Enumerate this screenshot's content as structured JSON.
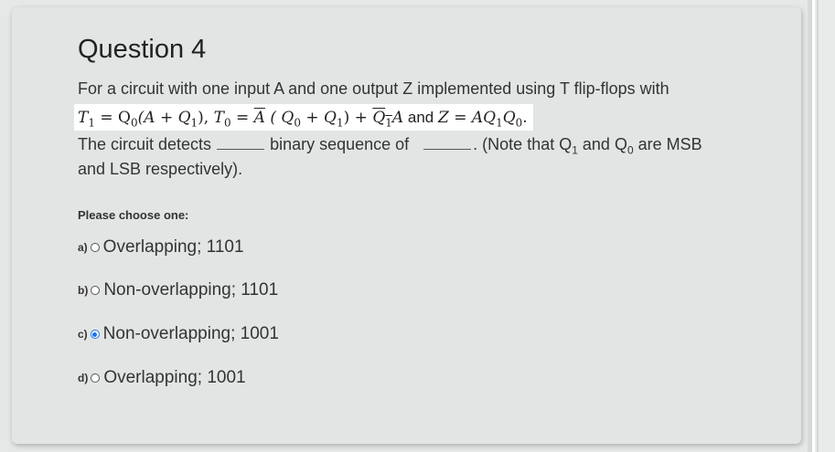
{
  "question": {
    "title": "Question 4",
    "intro": "For a circuit with one input A and one output Z implemented using T flip-flops with",
    "formula": {
      "t1_lhs": "T",
      "t1_sub": "1",
      "t1_eq": " = Q",
      "t1_rhs_sub1": "0",
      "t1_rhs_rest": "(A + Q",
      "t1_rhs_sub2": "1",
      "t1_close": "),",
      "t0_lhs": " T",
      "t0_sub": "0",
      "t0_eq": " = ",
      "t0_abar": "A",
      "t0_mid": " ( Q",
      "t0_sub2": "0",
      "t0_plus": " + Q",
      "t0_sub3": "1",
      "t0_close": ") + ",
      "t0_q1bar": "Q",
      "t0_q1bar_sub": "1",
      "t0_tail": "A",
      "and_word": " and ",
      "z_lhs": "Z",
      "z_eq": " = AQ",
      "z_sub1": "1",
      "z_q": "Q",
      "z_sub2": "0",
      "z_end": "."
    },
    "line3_a": "The circuit detects",
    "line3_b": "binary sequence of",
    "line3_c": ". (Note that Q",
    "line3_sub1": "1",
    "line3_d": " and Q",
    "line3_sub2": "0",
    "line3_e": " are MSB",
    "line4": "and LSB respectively)."
  },
  "prompt": "Please choose one:",
  "options": [
    {
      "letter": "a)",
      "text": "Overlapping; 1101",
      "selected": false
    },
    {
      "letter": "b)",
      "text": "Non-overlapping; 1101",
      "selected": false
    },
    {
      "letter": "c)",
      "text": "Non-overlapping; 1001",
      "selected": true
    },
    {
      "letter": "d)",
      "text": "Overlapping; 1001",
      "selected": false
    }
  ],
  "colors": {
    "accent": "#1a73e8",
    "card": "#e3e5e5",
    "page": "#e6e8e8"
  }
}
